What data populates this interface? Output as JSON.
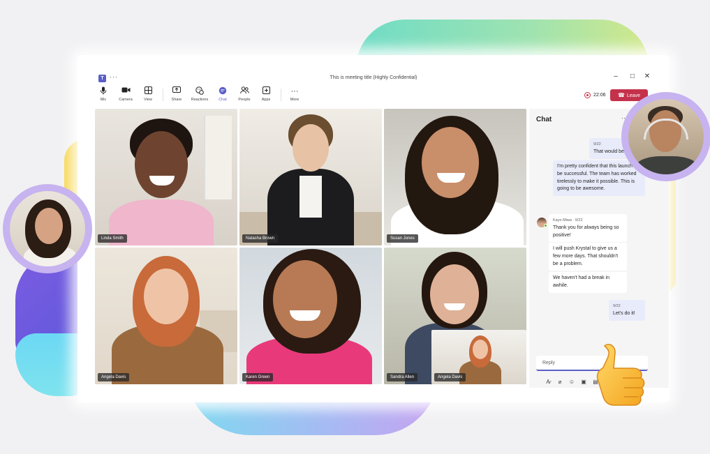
{
  "window": {
    "title": "This is meeting title (Highly Confidential)",
    "menu_dots": "···",
    "controls": {
      "minimize": "–",
      "maximize": "□",
      "close": "✕"
    }
  },
  "toolbar": {
    "items": [
      {
        "label": "Mic",
        "icon": "microphone-icon"
      },
      {
        "label": "Camera",
        "icon": "camera-icon"
      },
      {
        "label": "View",
        "icon": "grid-view-icon"
      },
      {
        "label": "Share",
        "icon": "share-screen-icon"
      },
      {
        "label": "Reactions",
        "icon": "reactions-icon"
      },
      {
        "label": "Chat",
        "icon": "chat-icon",
        "active": true
      },
      {
        "label": "People",
        "icon": "people-icon"
      },
      {
        "label": "Apps",
        "icon": "apps-icon"
      },
      {
        "label": "More",
        "icon": "more-icon"
      }
    ],
    "timer": "22:06",
    "leave_label": "Leave"
  },
  "participants": [
    {
      "name": "Linda Smith"
    },
    {
      "name": "Natasha Brown"
    },
    {
      "name": "Susan Jones"
    },
    {
      "name": "Angela Davis"
    },
    {
      "name": "Karen Green"
    },
    {
      "name": "Sandra Allen"
    }
  ],
  "self_view": {
    "name": "Angela Davis"
  },
  "chat": {
    "title": "Chat",
    "more": "···",
    "messages": [
      {
        "from": "me",
        "time": "9/22",
        "text": "That would be ..."
      },
      {
        "from": "me",
        "text": "I'm pretty confident that this launch will be successful. The team has worked tirelessly to make it possible. This is going to be awesome."
      },
      {
        "from": "other",
        "sender": "Kayo Miwa",
        "time": "9/22",
        "text": "Thank you for always being so positive!"
      },
      {
        "from": "other",
        "text": "I will push Krystal to give us a few more days. That shouldn't be a problem."
      },
      {
        "from": "other",
        "text": "We haven't had a break in awhile."
      },
      {
        "from": "me",
        "time": "9/22",
        "text": "Let's do it!"
      }
    ],
    "reply_placeholder": "Reply",
    "compose_tools": [
      "format-icon",
      "attach-icon",
      "emoji-icon",
      "gif-icon",
      "sticker-icon"
    ]
  },
  "colors": {
    "accent": "#5b5fc7",
    "leave": "#c4314b",
    "chat_me_bubble": "#e8ebfa"
  }
}
